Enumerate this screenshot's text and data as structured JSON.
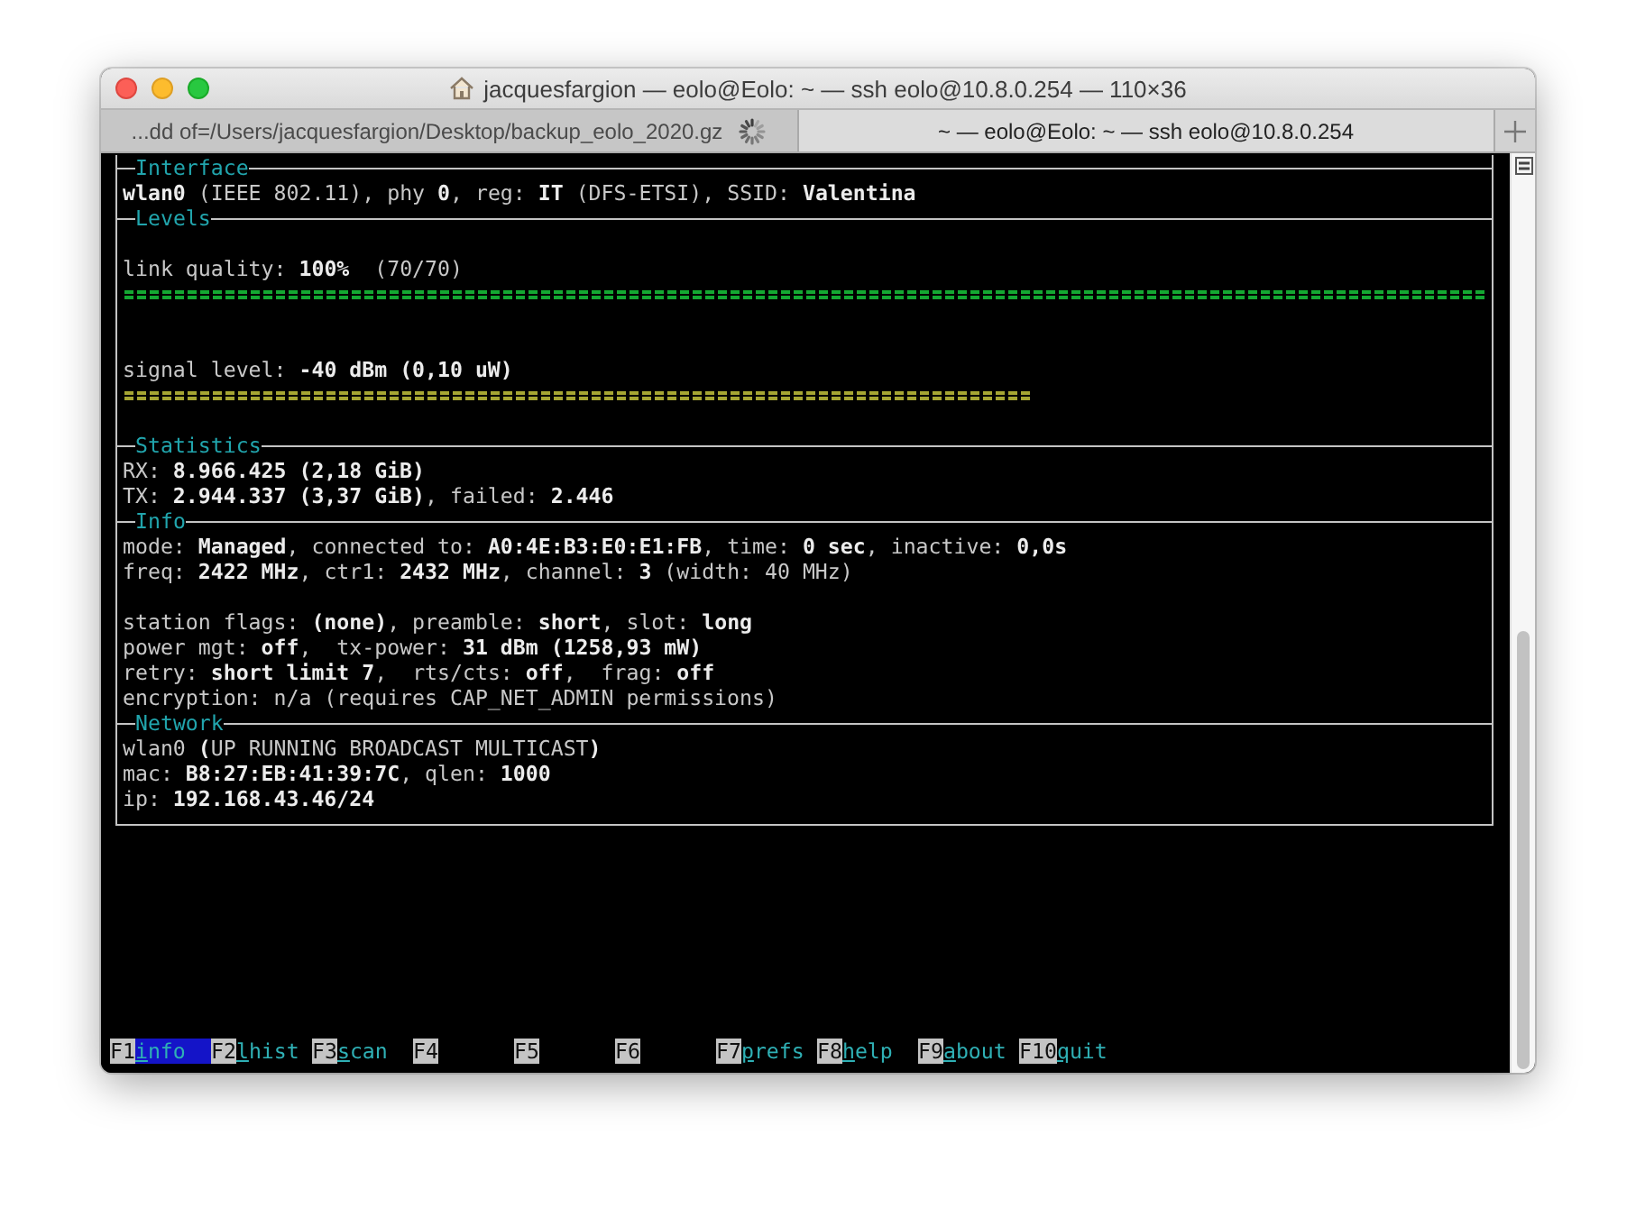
{
  "window": {
    "title": "jacquesfargion — eolo@Eolo: ~ — ssh eolo@10.8.0.254 — 110×36"
  },
  "tabs": [
    {
      "label": "...dd of=/Users/jacquesfargion/Desktop/backup_eolo_2020.gz",
      "selected": false,
      "busy": true
    },
    {
      "label": "~ — eolo@Eolo: ~ — ssh eolo@10.8.0.254",
      "selected": true,
      "busy": false
    }
  ],
  "sections": [
    {
      "title": "Interface",
      "lines": [
        {
          "kind": "text",
          "text": "**wlan0** (IEEE 802.11), phy **0**, reg: **IT** (DFS-ETSI), SSID: **Valentina**"
        }
      ]
    },
    {
      "title": "Levels",
      "lines": [
        {
          "kind": "blank"
        },
        {
          "kind": "text",
          "text": "link quality: **100%**  (70/70)"
        },
        {
          "kind": "bar",
          "color": "#14a832",
          "level": 1.0
        },
        {
          "kind": "blank"
        },
        {
          "kind": "blank"
        },
        {
          "kind": "text",
          "text": "signal level: **-40 dBm (0,10 uW)**"
        },
        {
          "kind": "bar",
          "color": "#a6a633",
          "level": 0.667
        },
        {
          "kind": "blank"
        }
      ]
    },
    {
      "title": "Statistics",
      "lines": [
        {
          "kind": "text",
          "text": "RX: **8.966.425 (2,18 GiB)**"
        },
        {
          "kind": "text",
          "text": "TX: **2.944.337 (3,37 GiB)**, failed: **2.446**"
        }
      ]
    },
    {
      "title": "Info",
      "lines": [
        {
          "kind": "text",
          "text": "mode: **Managed**, connected to: **A0:4E:B3:E0:E1:FB**, time: **0 sec**, inactive: **0,0s**"
        },
        {
          "kind": "text",
          "text": "freq: **2422 MHz**, ctr1: **2432 MHz**, channel: **3** (width: 40 MHz)"
        },
        {
          "kind": "blank"
        },
        {
          "kind": "text",
          "text": "station flags: **(none)**, preamble: **short**, slot: **long**"
        },
        {
          "kind": "text",
          "text": "power mgt: **off**,  tx-power: **31 dBm (1258,93 mW)**"
        },
        {
          "kind": "text",
          "text": "retry: **short limit 7**,  rts/cts: **off**,  frag: **off**"
        },
        {
          "kind": "text",
          "text": "encryption: n/a (requires CAP_NET_ADMIN permissions)"
        }
      ]
    },
    {
      "title": "Network",
      "lines": [
        {
          "kind": "text",
          "text": "wlan0 **(**UP RUNNING BROADCAST MULTICAST**)**"
        },
        {
          "kind": "text",
          "text": "mac: **B8:27:EB:41:39:7C**, qlen: **1000**"
        },
        {
          "kind": "text",
          "text": "ip: **192.168.43.46/24**"
        }
      ]
    }
  ],
  "function_keys": [
    {
      "key": "F1",
      "label": "info",
      "selected": true
    },
    {
      "key": "F2",
      "label": "lhist",
      "selected": false
    },
    {
      "key": "F3",
      "label": "scan",
      "selected": false
    },
    {
      "key": "F4"
    },
    {
      "key": "F5"
    },
    {
      "key": "F6"
    },
    {
      "key": "F7",
      "label": "prefs",
      "selected": false
    },
    {
      "key": "F8",
      "label": "help",
      "selected": false
    },
    {
      "key": "F9",
      "label": "about",
      "selected": false
    },
    {
      "key": "F10",
      "label": "quit",
      "selected": false
    }
  ]
}
